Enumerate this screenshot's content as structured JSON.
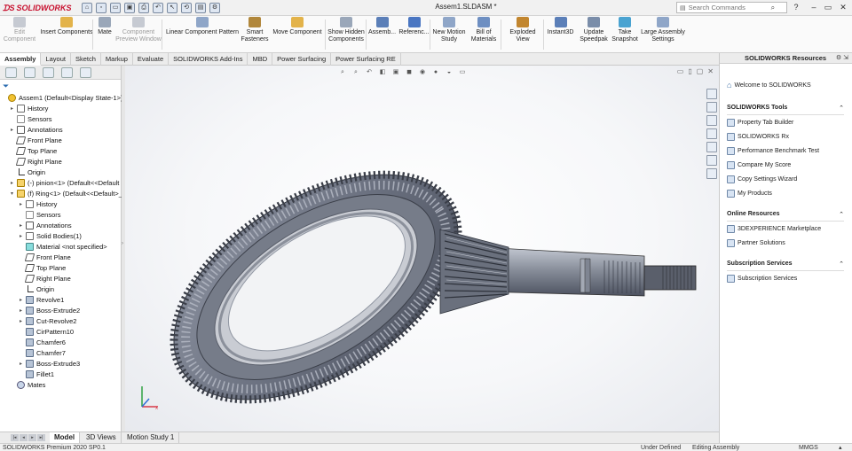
{
  "app": {
    "logo_text": "SOLIDWORKS",
    "document_title": "Assem1.SLDASM *",
    "search_placeholder": "Search Commands"
  },
  "ribbon": [
    {
      "label1": "Edit",
      "label2": "Component",
      "disabled": true
    },
    {
      "label1": "Insert Components",
      "label2": "",
      "disabled": false
    },
    {
      "label1": "Mate",
      "label2": "",
      "disabled": false
    },
    {
      "label1": "Component",
      "label2": "Preview Window",
      "disabled": true
    },
    {
      "label1": "Linear Component Pattern",
      "label2": "",
      "disabled": false
    },
    {
      "label1": "Smart",
      "label2": "Fasteners",
      "disabled": false
    },
    {
      "label1": "Move Component",
      "label2": "",
      "disabled": false
    },
    {
      "label1": "Show Hidden",
      "label2": "Components",
      "disabled": false
    },
    {
      "label1": "Assemb...",
      "label2": "",
      "disabled": false
    },
    {
      "label1": "Referenc...",
      "label2": "",
      "disabled": false
    },
    {
      "label1": "New Motion",
      "label2": "Study",
      "disabled": false
    },
    {
      "label1": "Bill of",
      "label2": "Materials",
      "disabled": false
    },
    {
      "label1": "Exploded View",
      "label2": "",
      "disabled": false
    },
    {
      "label1": "Instant3D",
      "label2": "",
      "disabled": false
    },
    {
      "label1": "Update",
      "label2": "Speedpak",
      "disabled": false
    },
    {
      "label1": "Take",
      "label2": "Snapshot",
      "disabled": false
    },
    {
      "label1": "Large Assembly",
      "label2": "Settings",
      "disabled": false
    }
  ],
  "command_tabs": [
    "Assembly",
    "Layout",
    "Sketch",
    "Markup",
    "Evaluate",
    "SOLIDWORKS Add-Ins",
    "MBD",
    "Power Surfacing",
    "Power Surfacing RE"
  ],
  "tree": [
    {
      "label": "Assem1  (Default<Display State-1>)",
      "icon": "asm",
      "level": 0,
      "exp": ""
    },
    {
      "label": "History",
      "icon": "folder",
      "level": 1,
      "exp": "▸"
    },
    {
      "label": "Sensors",
      "icon": "sensor",
      "level": 1,
      "exp": ""
    },
    {
      "label": "Annotations",
      "icon": "annot",
      "level": 1,
      "exp": "▸"
    },
    {
      "label": "Front Plane",
      "icon": "plane",
      "level": 1,
      "exp": ""
    },
    {
      "label": "Top Plane",
      "icon": "plane",
      "level": 1,
      "exp": ""
    },
    {
      "label": "Right Plane",
      "icon": "plane",
      "level": 1,
      "exp": ""
    },
    {
      "label": "Origin",
      "icon": "origin",
      "level": 1,
      "exp": ""
    },
    {
      "label": "(-) pinion<1> (Default<<Default",
      "icon": "part",
      "level": 1,
      "exp": "▸"
    },
    {
      "label": "(f) Ring<1> (Default<<Default>_",
      "icon": "part",
      "level": 1,
      "exp": "▾"
    },
    {
      "label": "History",
      "icon": "folder",
      "level": 2,
      "exp": "▸"
    },
    {
      "label": "Sensors",
      "icon": "sensor",
      "level": 2,
      "exp": ""
    },
    {
      "label": "Annotations",
      "icon": "annot",
      "level": 2,
      "exp": "▸"
    },
    {
      "label": "Solid Bodies(1)",
      "icon": "folder",
      "level": 2,
      "exp": "▸"
    },
    {
      "label": "Material <not specified>",
      "icon": "mat",
      "level": 2,
      "exp": ""
    },
    {
      "label": "Front Plane",
      "icon": "plane",
      "level": 2,
      "exp": ""
    },
    {
      "label": "Top Plane",
      "icon": "plane",
      "level": 2,
      "exp": ""
    },
    {
      "label": "Right Plane",
      "icon": "plane",
      "level": 2,
      "exp": ""
    },
    {
      "label": "Origin",
      "icon": "origin",
      "level": 2,
      "exp": ""
    },
    {
      "label": "Revolve1",
      "icon": "feat",
      "level": 2,
      "exp": "▸"
    },
    {
      "label": "Boss-Extrude2",
      "icon": "feat",
      "level": 2,
      "exp": "▸"
    },
    {
      "label": "Cut-Revolve2",
      "icon": "feat",
      "level": 2,
      "exp": "▸"
    },
    {
      "label": "CirPattern10",
      "icon": "feat",
      "level": 2,
      "exp": ""
    },
    {
      "label": "Chamfer6",
      "icon": "feat",
      "level": 2,
      "exp": ""
    },
    {
      "label": "Chamfer7",
      "icon": "feat",
      "level": 2,
      "exp": ""
    },
    {
      "label": "Boss-Extrude3",
      "icon": "feat",
      "level": 2,
      "exp": "▸"
    },
    {
      "label": "Fillet1",
      "icon": "feat",
      "level": 2,
      "exp": ""
    },
    {
      "label": "Mates",
      "icon": "mates",
      "level": 1,
      "exp": ""
    }
  ],
  "resources": {
    "title": "SOLIDWORKS Resources",
    "welcome": "Welcome to SOLIDWORKS",
    "sections": [
      {
        "title": "SOLIDWORKS Tools",
        "items": [
          "Property Tab Builder",
          "SOLIDWORKS Rx",
          "Performance Benchmark Test",
          "Compare My Score",
          "Copy Settings Wizard",
          "My Products"
        ]
      },
      {
        "title": "Online Resources",
        "items": [
          "3DEXPERIENCE Marketplace",
          "Partner Solutions"
        ]
      },
      {
        "title": "Subscription Services",
        "items": [
          "Subscription Services"
        ]
      }
    ]
  },
  "bottom_tabs": [
    "Model",
    "3D Views",
    "Motion Study 1"
  ],
  "status": {
    "product": "SOLIDWORKS Premium 2020 SP0.1",
    "state": "Under Defined",
    "mode": "Editing Assembly",
    "units": "MMGS"
  },
  "colors": {
    "accent": "#c8102e",
    "gear_dark": "#4a5060",
    "gear_light": "#a7adb9"
  }
}
